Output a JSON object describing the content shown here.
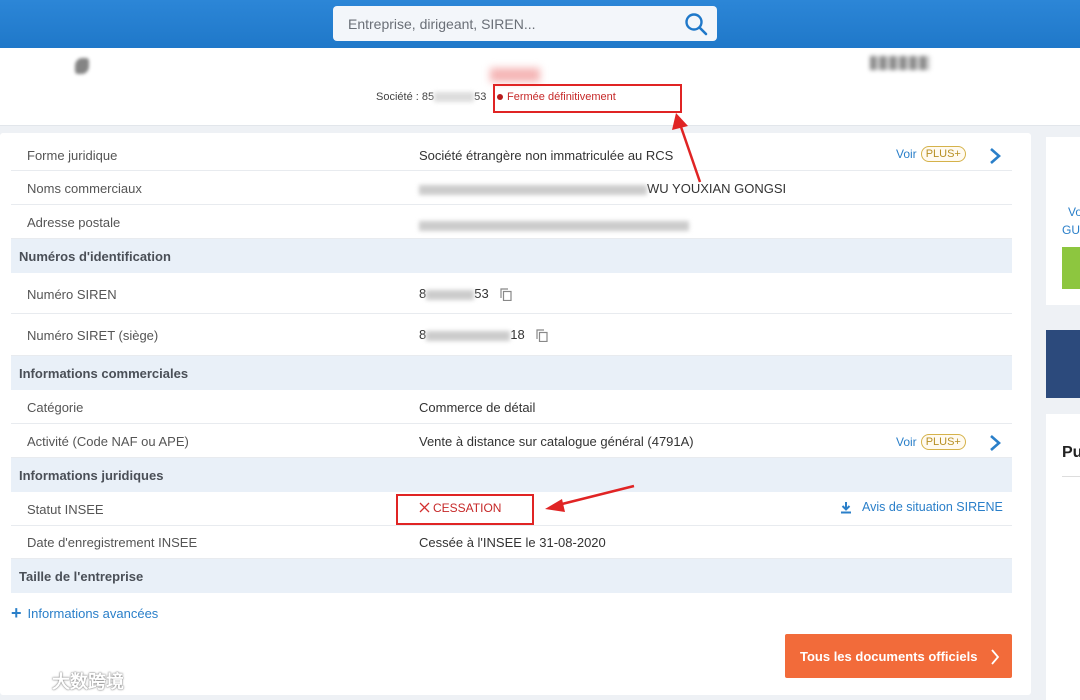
{
  "search": {
    "placeholder": "Entreprise, dirigeant, SIREN..."
  },
  "header": {
    "company_prefix": "Société : 85",
    "company_suffix": "53",
    "status": "Fermée définitivement"
  },
  "rows": {
    "forme": {
      "label": "Forme juridique",
      "value": "Société étrangère non immatriculée au RCS"
    },
    "noms": {
      "label": "Noms commerciaux",
      "value_visible": "WU YOUXIAN GONGSI"
    },
    "adresse": {
      "label": "Adresse postale"
    },
    "siren": {
      "label": "Numéro SIREN",
      "prefix": "8",
      "suffix": "53"
    },
    "siret": {
      "label": "Numéro SIRET (siège)",
      "prefix": "8",
      "suffix": "18"
    },
    "categorie": {
      "label": "Catégorie",
      "value": "Commerce de détail"
    },
    "activite": {
      "label": "Activité (Code NAF ou APE)",
      "value": "Vente à distance sur catalogue général (4791A)"
    },
    "statut": {
      "label": "Statut INSEE",
      "value": "CESSATION"
    },
    "date": {
      "label": "Date d'enregistrement INSEE",
      "value": "Cessée à l'INSEE le 31-08-2020"
    }
  },
  "sections": {
    "identification": "Numéros d'identification",
    "commerciales": "Informations commerciales",
    "juridiques": "Informations juridiques",
    "taille": "Taille de l'entreprise"
  },
  "links": {
    "voir": "Voir",
    "plus": "PLUS+",
    "avis": "Avis de situation SIRENE",
    "advanced": "Informations avancées"
  },
  "buttons": {
    "documents": "Tous les documents officiels"
  },
  "sidebar": {
    "line1": "Vo",
    "line2": "GU",
    "heading": "Pu"
  },
  "watermark": {
    "text": "大数跨境"
  },
  "colors": {
    "topbar": "#1f78c9",
    "link": "#2a7fc9",
    "alert_red": "#e02424",
    "cta_orange": "#f26b3a",
    "section_bg": "#e9f0f8"
  }
}
